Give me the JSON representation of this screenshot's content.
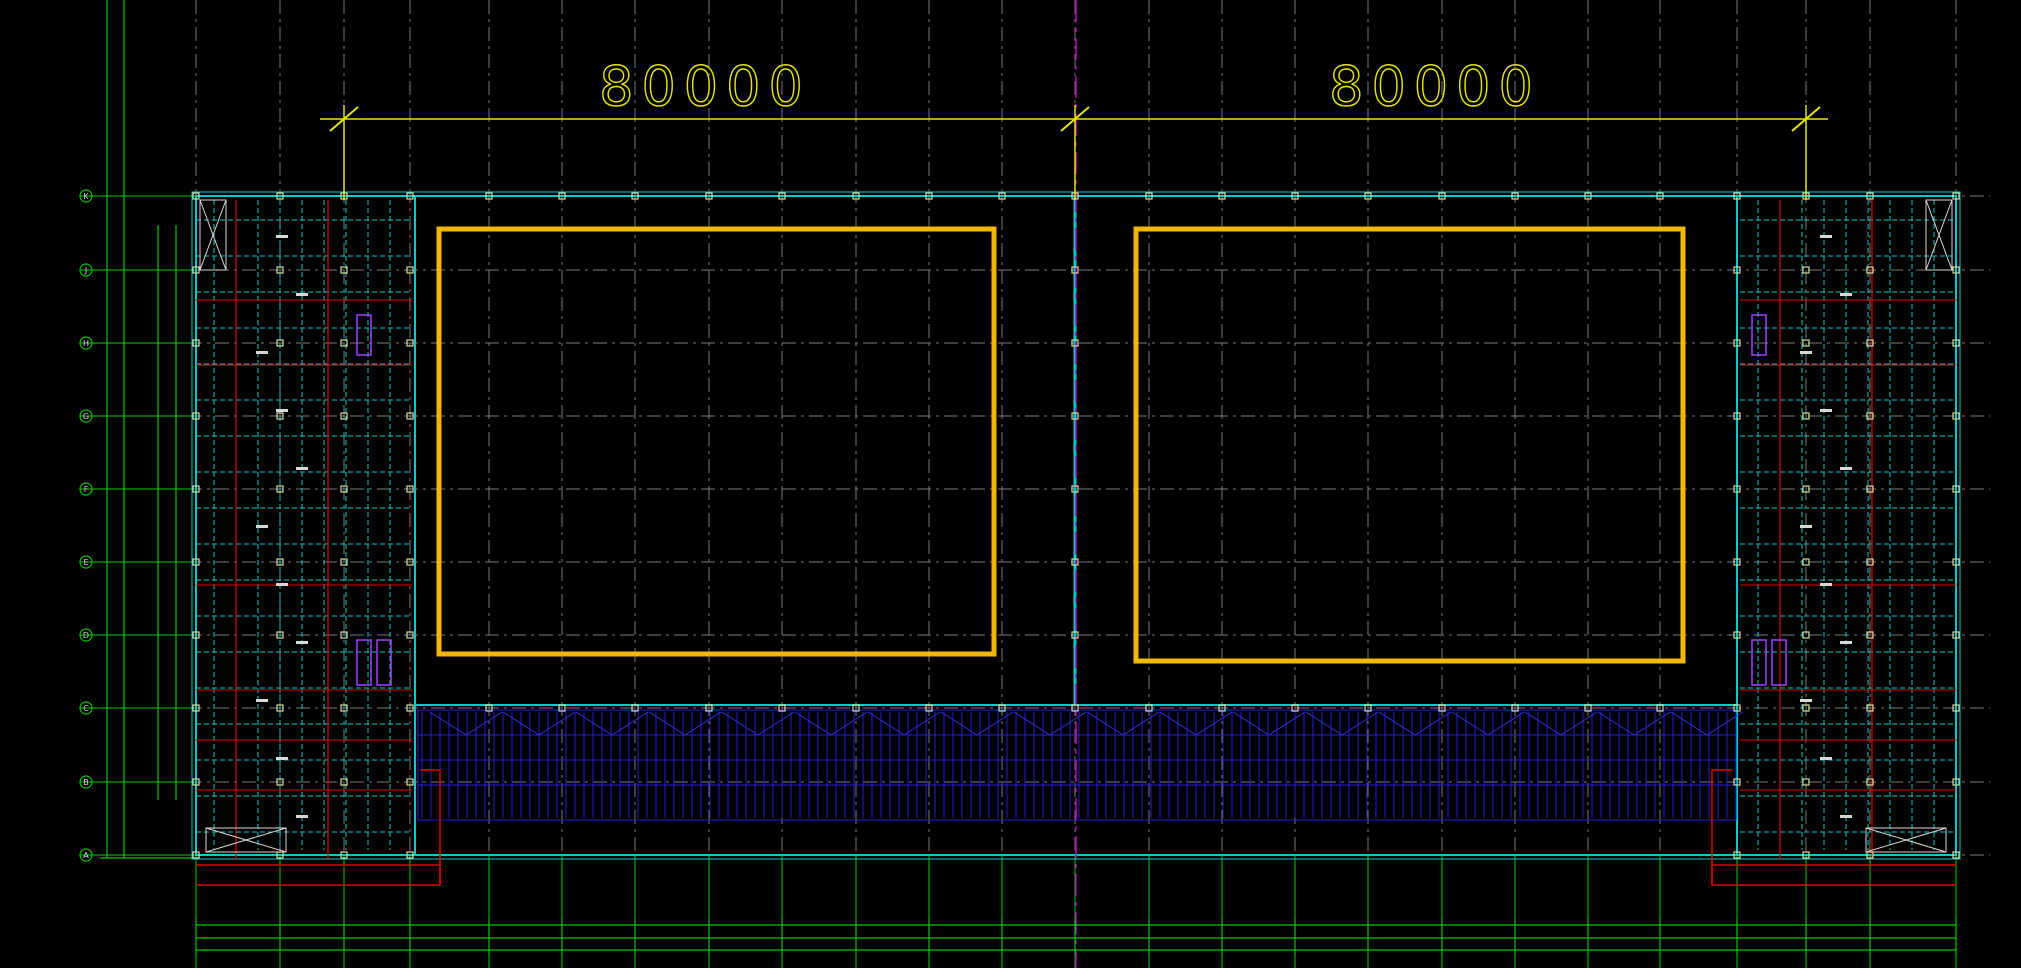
{
  "dimensions": {
    "left_span": "80000",
    "right_span": "80000"
  },
  "axes": {
    "rows": [
      "K",
      "J",
      "H",
      "G",
      "F",
      "E",
      "D",
      "C",
      "B",
      "A"
    ]
  },
  "colors": {
    "background": "#000000",
    "grid_dash": "#7a7a7a",
    "grid_axis": "#00c800",
    "dimension": "#e6e600",
    "structure": "#00cccc",
    "red_lines": "#e00000",
    "column": "#d8d8a0",
    "panels": "#f2b705",
    "hatch": "#2020d8",
    "center_axis": "#c000c0",
    "purple_box": "#a040ff"
  }
}
